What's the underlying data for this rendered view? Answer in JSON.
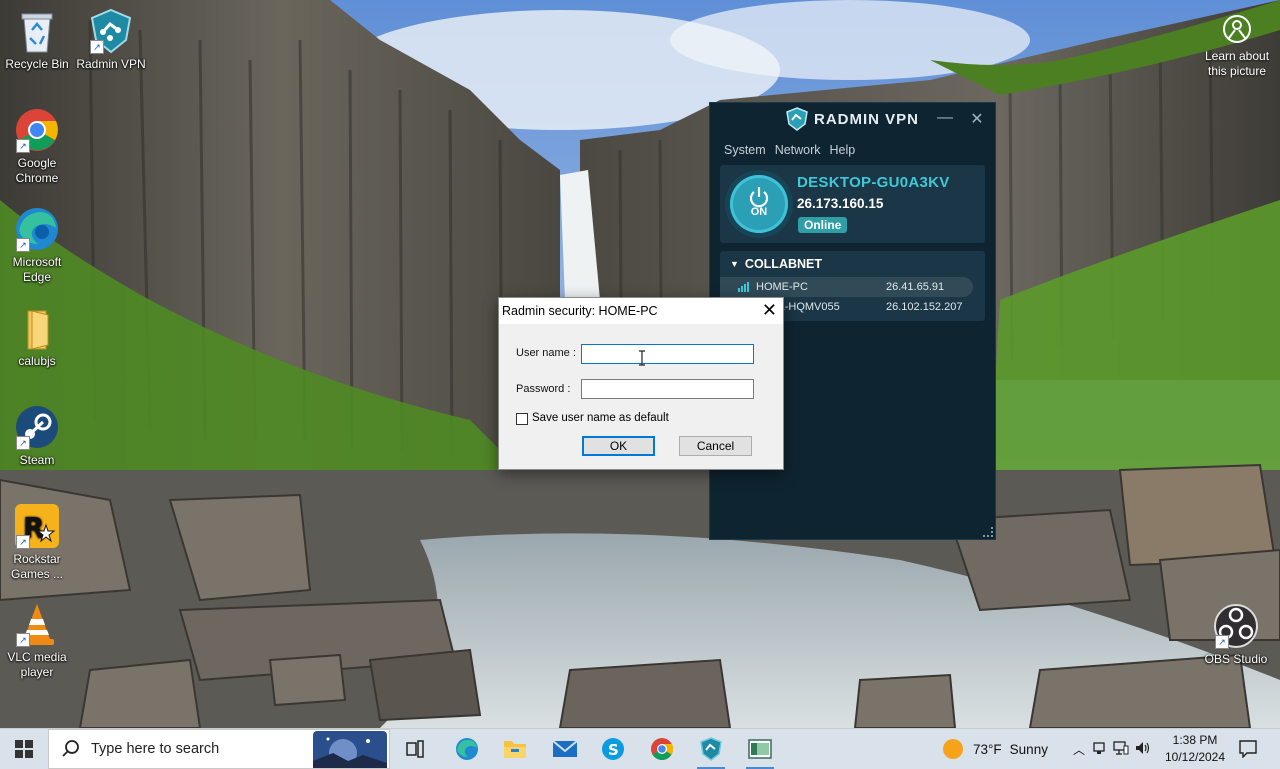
{
  "desktop": {
    "icons": [
      {
        "label": "Recycle Bin"
      },
      {
        "label": "Radmin VPN"
      },
      {
        "label": "Google Chrome"
      },
      {
        "label": "Microsoft Edge"
      },
      {
        "label": "calubjs"
      },
      {
        "label": "Steam"
      },
      {
        "label": "Rockstar Games ..."
      },
      {
        "label": "VLC media player"
      },
      {
        "label": "OBS Studio"
      }
    ],
    "learn_about": "Learn about this picture"
  },
  "radmin_vpn": {
    "title": "RADMIN VPN",
    "menu": [
      "System",
      "Network",
      "Help"
    ],
    "power_state": "ON",
    "hostname": "DESKTOP-GU0A3KV",
    "ip": "26.173.160.15",
    "status": "Online",
    "network": {
      "name": "COLLABNET",
      "peers": [
        {
          "name": "HOME-PC",
          "ip": "26.41.65.91"
        },
        {
          "name": "COLL-HQMV055",
          "ip": "26.102.152.207"
        }
      ]
    },
    "colors": {
      "background": "#0f2431",
      "accent": "#3fc8d8",
      "online": "#2e9fa6"
    }
  },
  "security_dialog": {
    "title": "Radmin security: HOME-PC",
    "username_label": "User name :",
    "username_value": "",
    "password_label": "Password :",
    "password_value": "",
    "save_default_label": "Save user name as default",
    "save_default_checked": false,
    "ok_label": "OK",
    "cancel_label": "Cancel"
  },
  "taskbar": {
    "search_placeholder": "Type here to search",
    "pinned": [
      "task-view",
      "edge",
      "file-explorer",
      "mail",
      "skype",
      "chrome",
      "radmin-vpn",
      "radmin-viewer"
    ],
    "weather_temp": "73°F",
    "weather_text": "Sunny",
    "time": "1:38 PM",
    "date": "10/12/2024"
  }
}
